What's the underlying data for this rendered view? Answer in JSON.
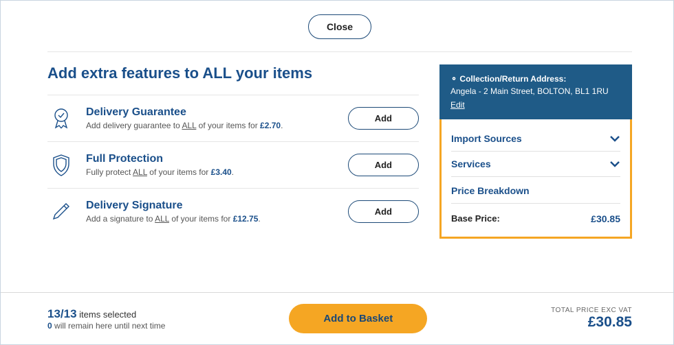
{
  "close_label": "Close",
  "page_title": "Add extra features to ALL your items",
  "features": [
    {
      "title": "Delivery Guarantee",
      "desc_prefix": "Add delivery guarantee to ",
      "all": "ALL",
      "desc_mid": " of your items for ",
      "price": "£2.70",
      "add": "Add"
    },
    {
      "title": "Full Protection",
      "desc_prefix": "Fully protect ",
      "all": "ALL",
      "desc_mid": " of your items for ",
      "price": "£3.40",
      "add": "Add"
    },
    {
      "title": "Delivery Signature",
      "desc_prefix": "Add a signature to ",
      "all": "ALL",
      "desc_mid": " of your items for ",
      "price": "£12.75",
      "add": "Add"
    }
  ],
  "address": {
    "title_prefix": "Collection/Return Address:",
    "line": "Angela - 2 Main Street, BOLTON, BL1 1RU",
    "edit": "Edit"
  },
  "accordion": {
    "import_sources": "Import Sources",
    "services": "Services",
    "price_breakdown": "Price Breakdown",
    "base_label": "Base Price:",
    "base_value": "£30.85"
  },
  "footer": {
    "count": "13/13",
    "items_selected": " items selected",
    "remain_count": "0",
    "remain_text": " will remain here until next time",
    "add_to_basket": "Add to Basket",
    "total_label": "TOTAL PRICE EXC VAT",
    "total_value": "£30.85"
  }
}
